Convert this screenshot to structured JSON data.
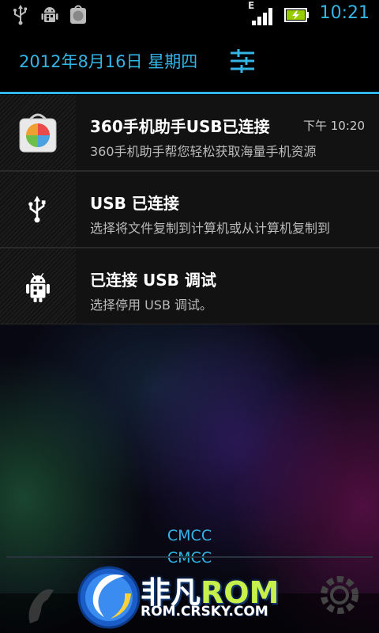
{
  "status_bar": {
    "icons": [
      "usb-icon",
      "android-debug-icon",
      "app-360-icon"
    ],
    "network_type": "E",
    "time": "10:21",
    "accent_color": "#33b5e5"
  },
  "header": {
    "date": "2012年8月16日 星期四",
    "settings_icon": "quick-settings-icon"
  },
  "notifications": [
    {
      "title": "360手机助手USB已连接",
      "time": "下午 10:20",
      "text": "360手机助手帮您轻松获取海量手机资源",
      "icon": "app-360-icon"
    },
    {
      "title": "USB 已连接",
      "time": "",
      "text": "选择将文件复制到计算机或从计算机复制到",
      "icon": "usb-icon"
    },
    {
      "title": "已连接 USB 调试",
      "time": "",
      "text": "选择停用 USB 调试。",
      "icon": "android-debug-icon"
    }
  ],
  "lockscreen": {
    "carrier_1": "CMCC",
    "carrier_2": "CMCC"
  },
  "watermark": {
    "brand_prefix": "非凡",
    "brand_suffix": "ROM",
    "url": "ROM.CRSKY.COM"
  }
}
